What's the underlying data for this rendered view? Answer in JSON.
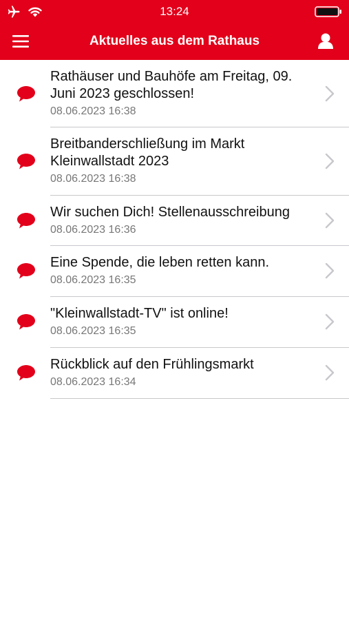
{
  "status_bar": {
    "time": "13:24"
  },
  "nav": {
    "title": "Aktuelles aus dem Rathaus",
    "menu_icon": "hamburger-icon",
    "profile_icon": "user-icon"
  },
  "theme": {
    "accent": "#e2001a",
    "text": "#111111",
    "secondary_text": "#777777",
    "divider": "#c8c7cc"
  },
  "news": [
    {
      "title_line1": "Rathäuser und Bauhöfe am Freitag, 09.",
      "title_line2": "Juni 2023 geschlossen!",
      "date": "08.06.2023 16:38"
    },
    {
      "title_line1": "Breitbanderschließung im Markt",
      "title_line2": "Kleinwallstadt 2023",
      "date": "08.06.2023 16:38"
    },
    {
      "title_line1": "Wir suchen Dich! Stellenausschreibung",
      "title_line2": "",
      "date": "08.06.2023 16:36"
    },
    {
      "title_line1": "Eine Spende, die leben retten kann.",
      "title_line2": "",
      "date": "08.06.2023 16:35"
    },
    {
      "title_line1": "\"Kleinwallstadt-TV\" ist online!",
      "title_line2": "",
      "date": "08.06.2023 16:35"
    },
    {
      "title_line1": "Rückblick auf den Frühlingsmarkt",
      "title_line2": "",
      "date": "08.06.2023 16:34"
    }
  ]
}
